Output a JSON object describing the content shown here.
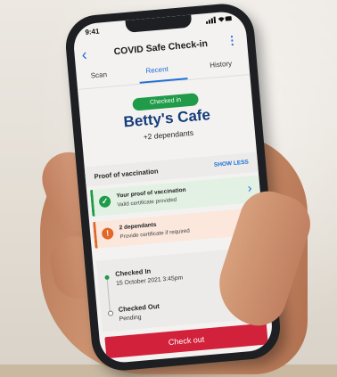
{
  "status_bar": {
    "time": "9:41",
    "icons": "📶 ◈ ▬"
  },
  "header": {
    "title": "COVID Safe Check-in",
    "back_icon": "chevron-left",
    "more_icon": "vertical-dots"
  },
  "tabs": [
    {
      "label": "Scan",
      "active": false
    },
    {
      "label": "Recent",
      "active": true
    },
    {
      "label": "History",
      "active": false
    }
  ],
  "checkin": {
    "badge": "Checked in",
    "venue": "Betty's Cafe",
    "dependants": "+2 dependants"
  },
  "vaccination": {
    "heading": "Proof of vaccination",
    "toggle_label": "SHOW LESS",
    "cards": [
      {
        "title": "Your proof of vaccination",
        "subtitle": "Valid certificate provided",
        "status": "ok",
        "icon": "check-circle",
        "color": "#1f9b49"
      },
      {
        "title": "2 dependants",
        "subtitle": "Provide certificate if required",
        "status": "warning",
        "icon": "exclamation-circle",
        "color": "#e2672a"
      }
    ]
  },
  "timeline": {
    "checked_in_title": "Checked In",
    "checked_in_time": "15 October 2021 3:45pm",
    "checked_out_title": "Checked Out",
    "checked_out_status": "Pending"
  },
  "action": {
    "checkout_label": "Check out",
    "color": "#d2213a"
  }
}
